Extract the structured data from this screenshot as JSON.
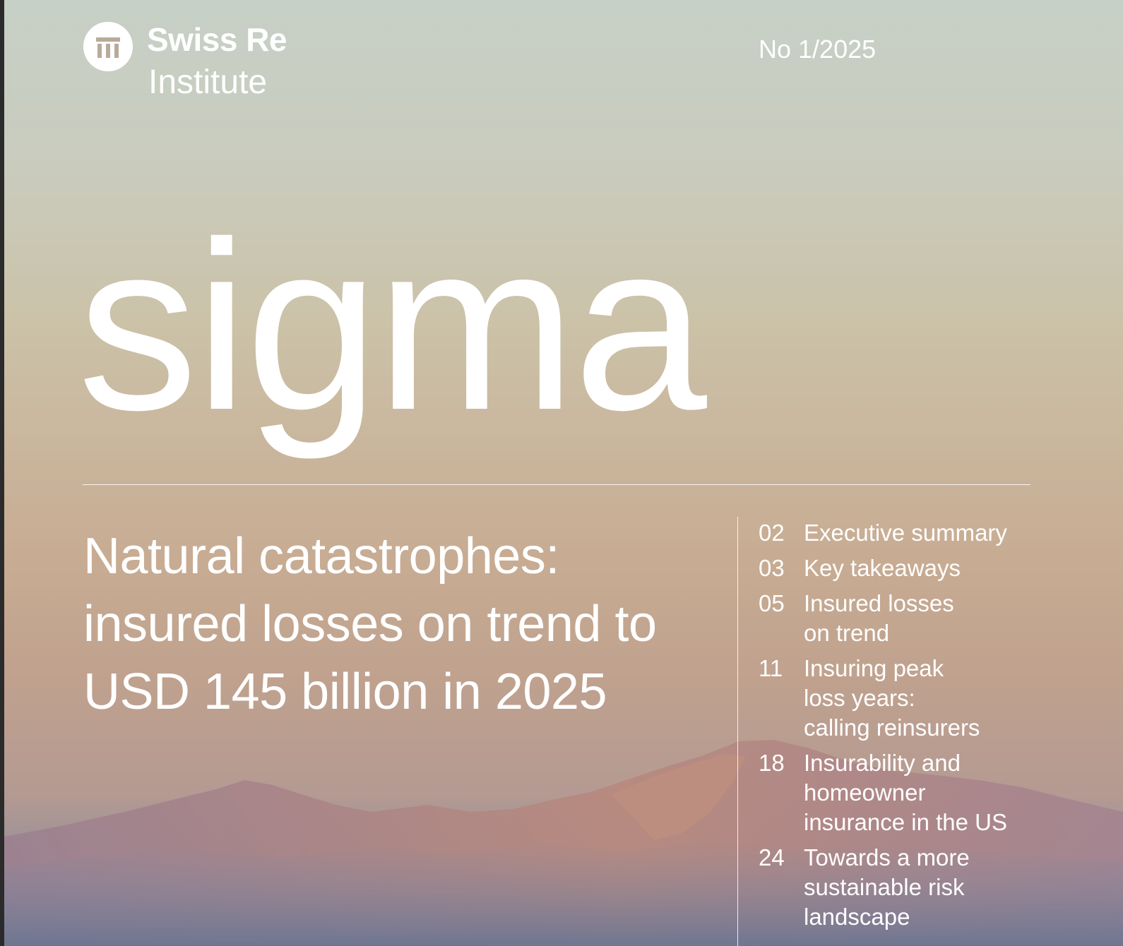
{
  "brand": {
    "name": "Swiss Re",
    "subtitle": "Institute",
    "logo_icon": "swiss-re-logo-icon"
  },
  "issue": "No 1/2025",
  "publication": "sigma",
  "headline": {
    "lines": [
      "Natural catastrophes:",
      "insured losses on trend to",
      "USD 145 billion in 2025"
    ]
  },
  "toc": [
    {
      "page": "02",
      "title": "Executive summary"
    },
    {
      "page": "03",
      "title": "Key takeaways"
    },
    {
      "page": "05",
      "title": "Insured losses\non trend"
    },
    {
      "page": "11",
      "title": "Insuring peak\nloss years:\ncalling reinsurers"
    },
    {
      "page": "18",
      "title": "Insurability and\nhomeowner\ninsurance in the US"
    },
    {
      "page": "24",
      "title": "Towards a more\nsustainable risk\nlandscape"
    }
  ],
  "colors": {
    "text": "#ffffff",
    "sky_top": "#c7d0c6",
    "sky_mid": "#c9b59c",
    "mountain": "#8e7d8a",
    "mountain_lit": "#b88a7c"
  }
}
